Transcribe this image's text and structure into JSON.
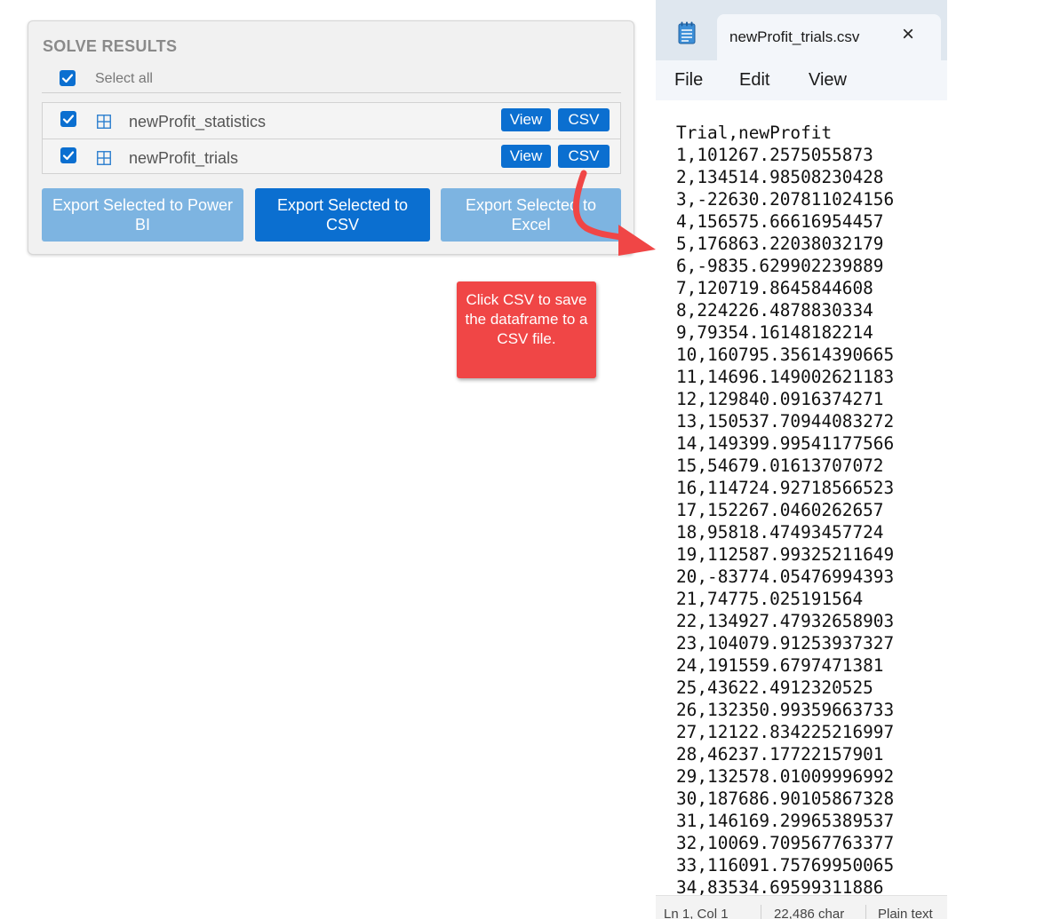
{
  "solve_results": {
    "title": "SOLVE RESULTS",
    "select_all_label": "Select all",
    "rows": [
      {
        "label": "newProfit_statistics",
        "view_label": "View",
        "csv_label": "CSV"
      },
      {
        "label": "newProfit_trials",
        "view_label": "View",
        "csv_label": "CSV"
      }
    ],
    "export_powerbi_label": "Export Selected to Power BI",
    "export_csv_label": "Export Selected to CSV",
    "export_excel_label": "Export Selected to Excel"
  },
  "callout": {
    "text": "Click CSV to save the dataframe to a CSV file."
  },
  "notepad": {
    "tab_title": "newProfit_trials.csv",
    "close_glyph": "×",
    "menu": {
      "file": "File",
      "edit": "Edit",
      "view": "View"
    },
    "content_lines": [
      "Trial,newProfit",
      "1,101267.2575055873",
      "2,134514.98508230428",
      "3,-22630.207811024156",
      "4,156575.66616954457",
      "5,176863.22038032179",
      "6,-9835.629902239889",
      "7,120719.8645844608",
      "8,224226.4878830334",
      "9,79354.16148182214",
      "10,160795.35614390665",
      "11,14696.149002621183",
      "12,129840.0916374271",
      "13,150537.70944083272",
      "14,149399.99541177566",
      "15,54679.01613707072",
      "16,114724.92718566523",
      "17,152267.0460262657",
      "18,95818.47493457724",
      "19,112587.99325211649",
      "20,-83774.05476994393",
      "21,74775.025191564",
      "22,134927.47932658903",
      "23,104079.91253937327",
      "24,191559.6797471381",
      "25,43622.4912320525",
      "26,132350.99359663733",
      "27,12122.834225216997",
      "28,46237.17722157901",
      "29,132578.01009996992",
      "30,187686.90105867328",
      "31,146169.29965389537",
      "32,10069.709567763377",
      "33,116091.75769950065",
      "34,83534.69599311886"
    ],
    "status": {
      "position": "Ln 1, Col 1",
      "chars": "22,486 char",
      "encoding": "Plain text"
    }
  },
  "colors": {
    "accent_blue": "#0b6fd0",
    "disabled_blue": "#7db4e1",
    "callout_red": "#f04646"
  }
}
